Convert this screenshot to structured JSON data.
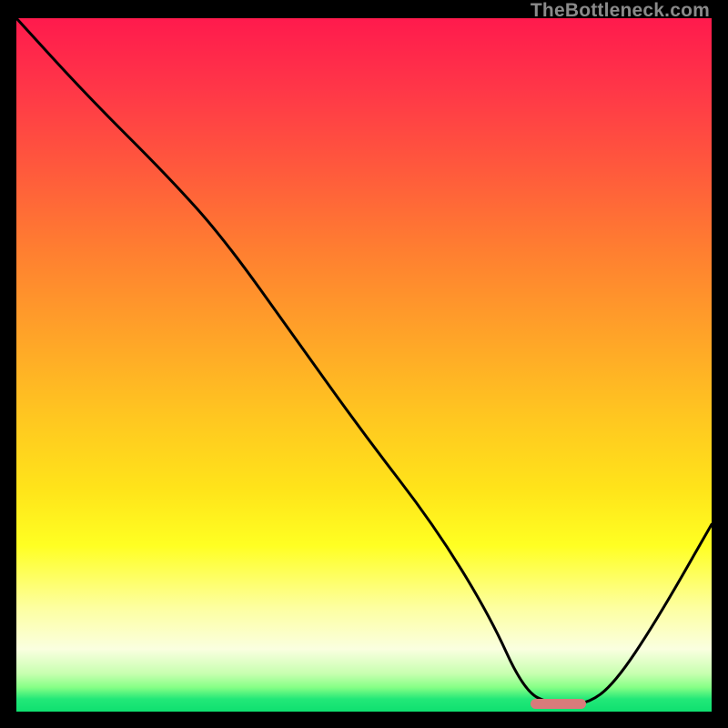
{
  "watermark": {
    "text": "TheBottleneck.com"
  },
  "chart_data": {
    "type": "line",
    "title": "",
    "xlabel": "",
    "ylabel": "",
    "xlim": [
      0,
      100
    ],
    "ylim": [
      0,
      100
    ],
    "grid": false,
    "legend": false,
    "series": [
      {
        "name": "bottleneck-curve",
        "color": "#000000",
        "x": [
          0,
          10,
          22,
          30,
          40,
          50,
          60,
          68,
          73,
          77,
          82,
          86,
          92,
          100
        ],
        "y": [
          100,
          89,
          77,
          68,
          54,
          40,
          27,
          14,
          3,
          1,
          1,
          4,
          13,
          27
        ]
      }
    ],
    "marker": {
      "x_start": 74,
      "x_end": 82,
      "y": 1.2,
      "color": "#d97b7b"
    },
    "gradient_bands": [
      {
        "y": 100,
        "color": "#ff1a4d"
      },
      {
        "y": 76,
        "color": "#ff8030"
      },
      {
        "y": 50,
        "color": "#ffc820"
      },
      {
        "y": 24,
        "color": "#ffff22"
      },
      {
        "y": 8,
        "color": "#faffe0"
      },
      {
        "y": 2,
        "color": "#22e878"
      }
    ]
  }
}
